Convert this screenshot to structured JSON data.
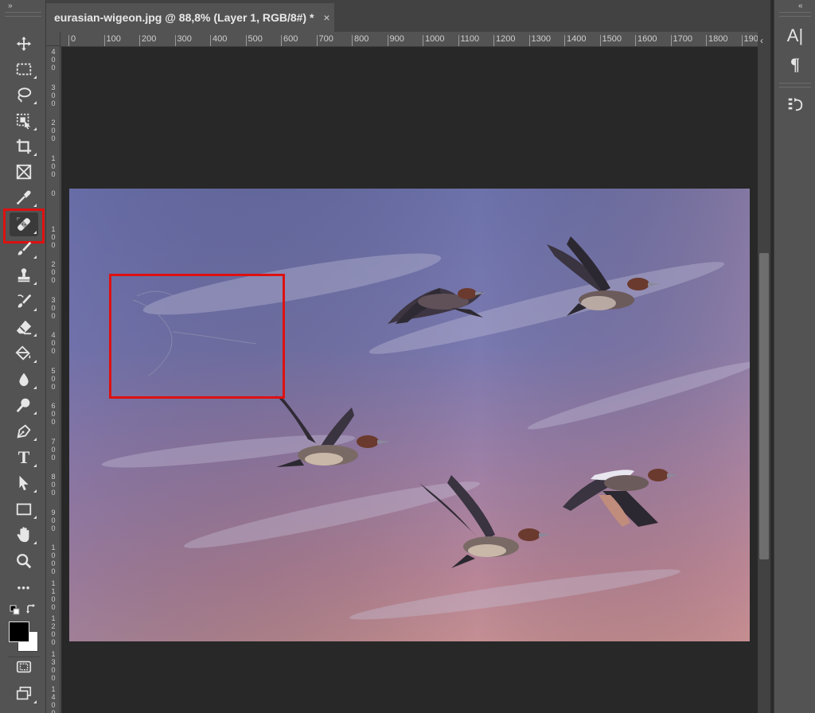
{
  "document_tab": {
    "title": "eurasian-wigeon.jpg @ 88,8% (Layer 1, RGB/8#) *",
    "close_glyph": "×"
  },
  "left_toolbar": {
    "collapse_glyph": "»",
    "tools": [
      {
        "name": "move-tool",
        "icon": "move-icon"
      },
      {
        "name": "rectangular-marquee-tool",
        "icon": "marquee-icon"
      },
      {
        "name": "lasso-tool",
        "icon": "lasso-icon"
      },
      {
        "name": "object-selection-tool",
        "icon": "object-select-icon"
      },
      {
        "name": "crop-tool",
        "icon": "crop-icon"
      },
      {
        "name": "frame-tool",
        "icon": "frame-icon"
      },
      {
        "name": "eyedropper-tool",
        "icon": "eyedropper-icon"
      },
      {
        "name": "spot-healing-brush-tool",
        "icon": "bandage-icon",
        "selected": true
      },
      {
        "name": "brush-tool",
        "icon": "brush-icon"
      },
      {
        "name": "clone-stamp-tool",
        "icon": "stamp-icon"
      },
      {
        "name": "history-brush-tool",
        "icon": "history-brush-icon"
      },
      {
        "name": "eraser-tool",
        "icon": "eraser-icon"
      },
      {
        "name": "paint-bucket-tool",
        "icon": "bucket-icon"
      },
      {
        "name": "blur-tool",
        "icon": "drop-icon"
      },
      {
        "name": "dodge-tool",
        "icon": "dodge-icon"
      },
      {
        "name": "pen-tool",
        "icon": "pen-icon"
      },
      {
        "name": "type-tool",
        "icon": "type-icon"
      },
      {
        "name": "path-selection-tool",
        "icon": "arrow-icon"
      },
      {
        "name": "rectangle-tool",
        "icon": "rectangle-icon"
      },
      {
        "name": "hand-tool",
        "icon": "hand-icon"
      },
      {
        "name": "zoom-tool",
        "icon": "zoom-icon"
      },
      {
        "name": "edit-toolbar",
        "icon": "more-icon"
      }
    ],
    "type_glyph": "T",
    "more_glyph": "•••",
    "foreground_color": "#000000",
    "background_color": "#ffffff"
  },
  "horizontal_ruler": {
    "labels": [
      "0",
      "100",
      "200",
      "300",
      "400",
      "500",
      "600",
      "700",
      "800",
      "900",
      "1000",
      "1100",
      "1200",
      "1300",
      "1400",
      "1500",
      "1600",
      "1700",
      "1800",
      "190"
    ]
  },
  "vertical_ruler": {
    "labels": [
      "4\n0\n0",
      "3\n0\n0",
      "2\n0\n0",
      "1\n0\n0",
      "0",
      "1\n0\n0",
      "2\n0\n0",
      "3\n0\n0",
      "4\n0\n0",
      "5\n0\n0",
      "6\n0\n0",
      "7\n0\n0",
      "8\n0\n0",
      "9\n0\n0",
      "1\n0\n0\n0",
      "1\n1\n0\n0",
      "1\n2\n0\n0",
      "1\n3\n0\n0",
      "1\n4\n0\n0"
    ]
  },
  "right_panel": {
    "collapse_glyph": "«",
    "buttons": [
      {
        "name": "character-panel-button",
        "glyph": "A|"
      },
      {
        "name": "paragraph-panel-button",
        "glyph": "¶"
      },
      {
        "name": "history-panel-button",
        "glyph": "⟲"
      }
    ]
  },
  "colors": {
    "highlight": "#dd1111",
    "workspace": "#282828",
    "panel": "#535353"
  }
}
